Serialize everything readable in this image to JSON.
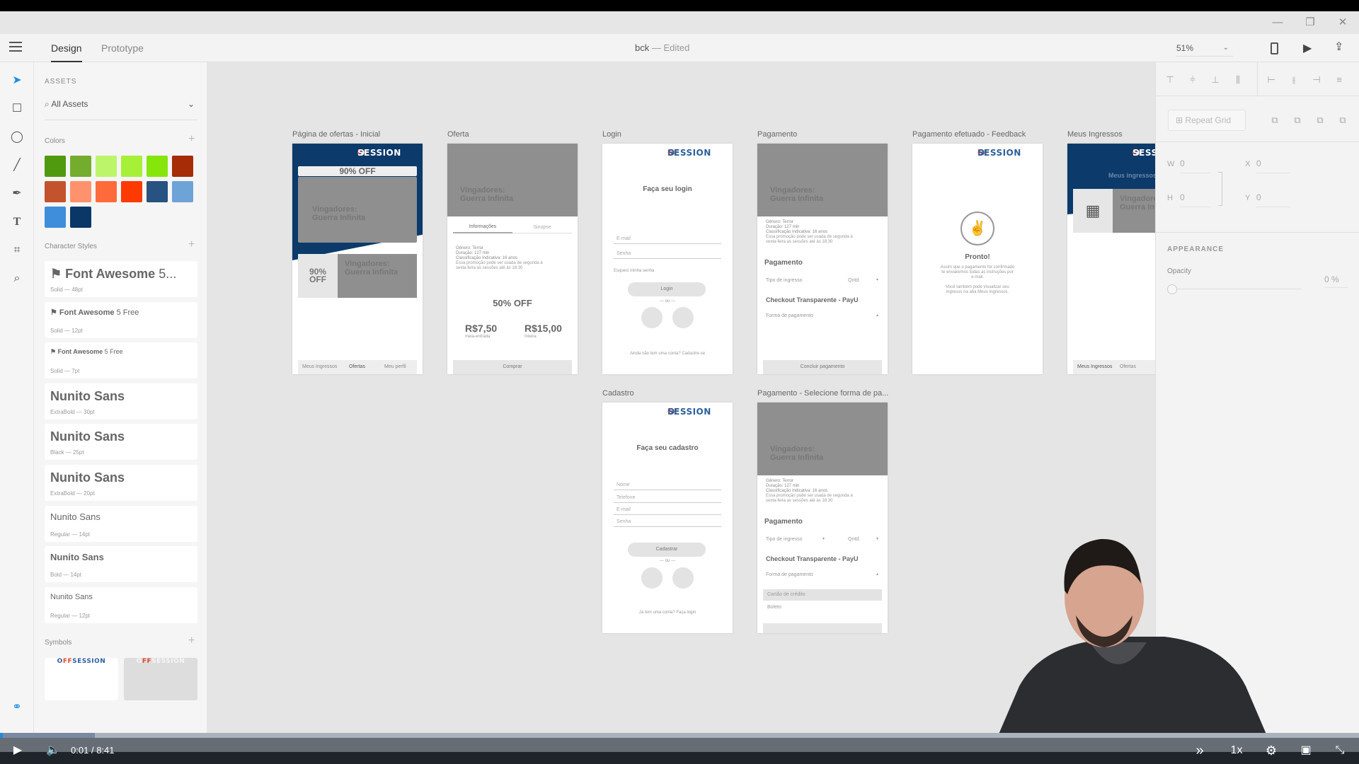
{
  "window": {
    "title": "bck",
    "status": "Edited",
    "separator": "—",
    "controls": [
      "minimize",
      "restore",
      "close"
    ]
  },
  "toolbar": {
    "tabs": [
      {
        "label": "Design",
        "active": true
      },
      {
        "label": "Prototype",
        "active": false
      }
    ],
    "zoom": "51%",
    "icons": [
      "device-preview-icon",
      "play-icon",
      "share-icon"
    ]
  },
  "tools": [
    "select-icon",
    "rectangle-icon",
    "ellipse-icon",
    "line-icon",
    "pen-icon",
    "text-icon",
    "artboard-icon",
    "zoom-icon",
    "plugins-icon"
  ],
  "assets": {
    "title": "ASSETS",
    "filter": "All Assets",
    "colors_label": "Colors",
    "colors": [
      "#4f9a0e",
      "#74ad2e",
      "#bdf56a",
      "#a6f037",
      "#86e60c",
      "#a62c08",
      "#c3532c",
      "#fe926d",
      "#fe6b3b",
      "#fe3a03",
      "#275282",
      "#6ea3d8",
      "#3e8edb",
      "#0b3768"
    ],
    "character_styles_label": "Character Styles",
    "character_styles": [
      {
        "name": "Font Awesome",
        "suffix": "5...",
        "spec": "Solid — 48pt"
      },
      {
        "name": "Font Awesome",
        "suffix": "5 Free",
        "spec": "Solid — 12pt"
      },
      {
        "name": "Font Awesome",
        "suffix": "5 Free",
        "spec": "Solid — 7pt"
      },
      {
        "name": "Nunito Sans",
        "spec": "ExtraBold — 30pt"
      },
      {
        "name": "Nunito Sans",
        "spec": "Black — 25pt"
      },
      {
        "name": "Nunito Sans",
        "spec": "ExtraBold — 20pt"
      },
      {
        "name": "Nunito Sans",
        "spec": "Regular — 14pt"
      },
      {
        "name": "Nunito Sans",
        "spec": "Bold — 14pt"
      },
      {
        "name": "Nunito Sans",
        "spec": "Regular — 12pt"
      }
    ],
    "symbols_label": "Symbols"
  },
  "brand": {
    "o": "O",
    "ff": "FF",
    "session": "SESSION",
    "blue": "#0b3a6b",
    "accent": "#e8452c"
  },
  "artboards": {
    "ofertas": {
      "label": "Página de ofertas - Inicial",
      "banner": "90% OFF",
      "movie": "Vingadores:",
      "movie2": "Guerra Infinita",
      "badge": "90%",
      "badge2": "OFF",
      "nav": [
        "Meus Ingressos",
        "Ofertas",
        "Meu perfil"
      ]
    },
    "oferta": {
      "label": "Oferta",
      "movie": "Vingadores:",
      "movie2": "Guerra Infinita",
      "tabs": [
        "Informações",
        "Sinopse"
      ],
      "info": [
        "Gênero: Terror",
        "Duração: 127 min",
        "Classificação Indicativa: 16 anos",
        "Essa promoção pode ser usada de segunda à",
        "sexta-feira as sessões até às 18:30"
      ],
      "discount": "50% OFF",
      "price1": "R$7,50",
      "price1_note": "meia-entrada",
      "price2": "R$15,00",
      "price2_note": "Inteira",
      "button": "Comprar"
    },
    "login": {
      "label": "Login",
      "title": "Faça seu login",
      "email": "E-mail",
      "password": "Senha",
      "forgot": "Esqueci minha senha",
      "button": "Login",
      "or": "— ou —",
      "signup": "Ainda não tem uma conta? Cadastre-se"
    },
    "pagamento": {
      "label": "Pagamento",
      "movie": "Vingadores:",
      "movie2": "Guerra Infinita",
      "heading": "Pagamento",
      "ticket_type": "Tipo de ingresso",
      "qty": "Qntd.",
      "checkout": "Checkout Transparente - PayU",
      "payment_method": "Forma de pagamento",
      "button": "Concluir pagamento"
    },
    "feedback": {
      "label": "Pagamento efetuado - Feedback",
      "title": "Pronto!",
      "text1": "Assim que o pagamento for confirmado te enviaremos todas as instruções por e-mail.",
      "text2": "Você também pode visualizar seu ingresso na aba Meus Ingressos."
    },
    "meus": {
      "label": "Meus Ingressos",
      "title": "Meus ingressos",
      "movie": "Vingadores:",
      "movie2": "Guerra Infinita",
      "nav": [
        "Meus Ingressos",
        "Ofertas"
      ]
    },
    "cadastro": {
      "label": "Cadastro",
      "title": "Faça seu cadastro",
      "fields": [
        "Nome",
        "Telefone",
        "E-mail",
        "Senha"
      ],
      "button": "Cadastrar",
      "or": "— ou —",
      "login": "Já tem uma conta? Faça login"
    },
    "pagamento2": {
      "label": "Pagamento - Selecione forma de pa...",
      "movie": "Vingadores:",
      "movie2": "Guerra Infinita",
      "heading": "Pagamento",
      "ticket_type": "Tipo de ingresso",
      "qty": "Qntd.",
      "checkout": "Checkout Transparente - PayU",
      "payment_method": "Forma de pagamento",
      "options": [
        "Cartão de crédito",
        "Boleto"
      ]
    }
  },
  "properties": {
    "repeat_grid": "Repeat Grid",
    "w_label": "W",
    "w": "0",
    "h_label": "H",
    "h": "0",
    "x_label": "X",
    "x": "0",
    "y_label": "Y",
    "y": "0",
    "appearance": "APPEARANCE",
    "opacity_label": "Opacity",
    "opacity": "0 %"
  },
  "video": {
    "current": "0:01",
    "separator": "/",
    "duration": "8:41",
    "progress": 0.2,
    "buffered": 7,
    "speed": "1x"
  }
}
